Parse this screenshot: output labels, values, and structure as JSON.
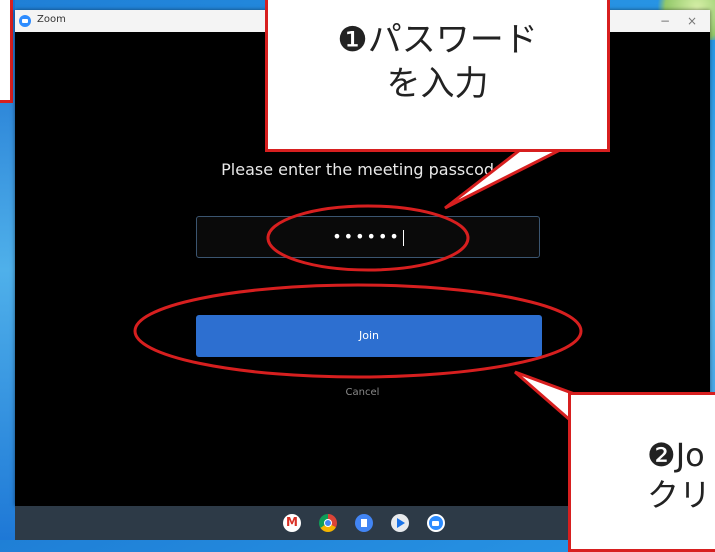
{
  "window": {
    "title": "Zoom",
    "minimize_label": "−",
    "close_label": "×"
  },
  "dialog": {
    "prompt": "Please enter the meeting passcode",
    "password_value": "••••••",
    "join_label": "Join",
    "cancel_label": "Cancel"
  },
  "annotations": {
    "callout1_line1": "❶パスワード",
    "callout1_line2": "を入力",
    "callout2_line1": "❷Jo",
    "callout2_line2": "クリ"
  },
  "taskbar": {
    "apps": [
      "gmail-icon",
      "chrome-icon",
      "docs-icon",
      "play-store-icon",
      "zoom-icon"
    ]
  },
  "colors": {
    "annotation_red": "#d71f1f",
    "join_blue": "#2d6fd0",
    "zoom_blue": "#2d8cff"
  }
}
